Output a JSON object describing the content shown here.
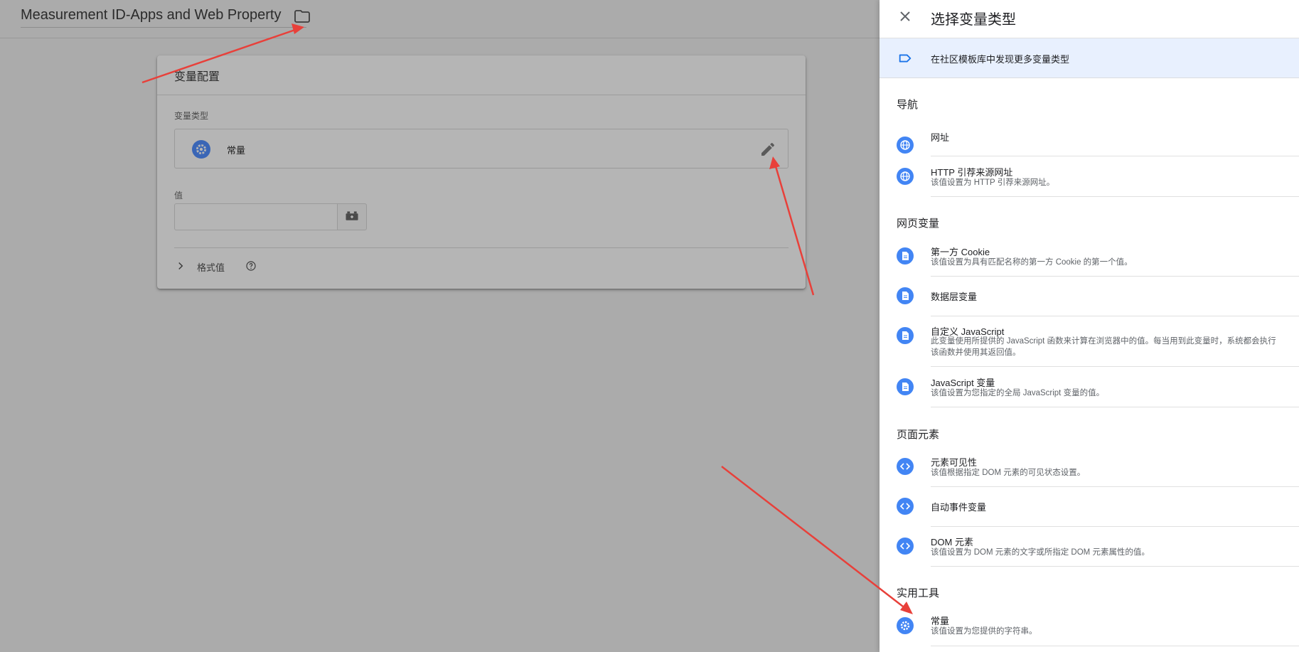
{
  "app": {
    "title": "Measurement ID-Apps and Web Property"
  },
  "config": {
    "card_title": "变量配置",
    "type_label": "变量类型",
    "type_value": "常量",
    "value_label": "值",
    "value_input": "",
    "format_label": "格式值"
  },
  "panel": {
    "title": "选择变量类型",
    "community_link": "在社区模板库中发现更多变量类型",
    "sections": {
      "nav": "导航",
      "page_vars": "网页变量",
      "page_elements": "页面元素",
      "utilities": "实用工具"
    },
    "items": {
      "url": {
        "title": "网址"
      },
      "http_referrer": {
        "title": "HTTP 引荐来源网址",
        "desc": "该值设置为 HTTP 引荐来源网址。"
      },
      "first_party_cookie": {
        "title": "第一方 Cookie",
        "desc": "该值设置为具有匹配名称的第一方 Cookie 的第一个值。"
      },
      "data_layer": {
        "title": "数据层变量"
      },
      "custom_js": {
        "title": "自定义 JavaScript",
        "desc1": "此变量使用所提供的 JavaScript 函数来计算在浏览器中的值。每当用到此变量时，系统都会执行",
        "desc2": "该函数并使用其返回值。"
      },
      "js_variable": {
        "title": "JavaScript 变量",
        "desc": "该值设置为您指定的全局 JavaScript 变量的值。"
      },
      "element_visibility": {
        "title": "元素可见性",
        "desc": "该值根据指定 DOM 元素的可见状态设置。"
      },
      "auto_event": {
        "title": "自动事件变量"
      },
      "dom_element": {
        "title": "DOM 元素",
        "desc": "该值设置为 DOM 元素的文字或所指定 DOM 元素属性的值。"
      },
      "constant": {
        "title": "常量",
        "desc": "该值设置为您提供的字符串。"
      }
    }
  },
  "colors": {
    "accent": "#4285f4",
    "annotation": "#e8403a",
    "community_bg": "#e8f0fe"
  },
  "icons": {
    "folder": "folder-icon",
    "pencil": "pencil-icon",
    "close": "close-icon",
    "tag": "label-tag-icon",
    "globe": "globe-icon",
    "doc": "document-icon",
    "code": "code-icon",
    "gear": "gear-icon",
    "chevron": "chevron-right-icon",
    "help": "help-icon",
    "brick": "variable-picker-icon"
  }
}
